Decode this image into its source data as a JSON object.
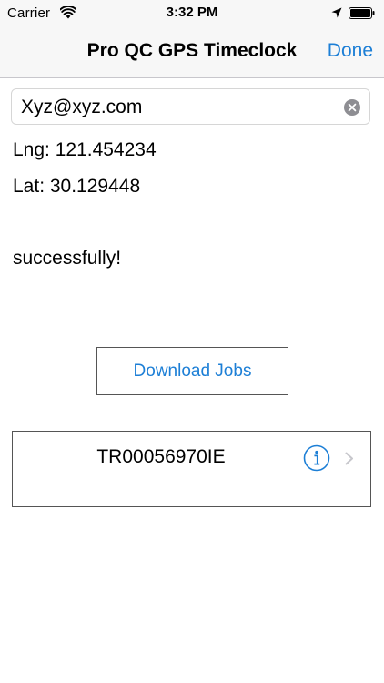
{
  "status_bar": {
    "carrier": "Carrier",
    "time": "3:32 PM"
  },
  "nav": {
    "title": "Pro QC GPS Timeclock",
    "done_label": "Done"
  },
  "email_field": {
    "value": "Xyz@xyz.com"
  },
  "location": {
    "lng_text": "Lng: 121.454234",
    "lat_text": "Lat: 30.129448"
  },
  "status_message": "successfully!",
  "download_button": {
    "label": "Download Jobs"
  },
  "jobs": [
    {
      "id": "TR00056970IE"
    }
  ],
  "colors": {
    "accent": "#1d7fd6",
    "bar_bg": "#f7f7f7"
  },
  "icons": {
    "wifi": "wifi-icon",
    "location": "location-arrow-icon",
    "battery": "battery-icon",
    "clear": "clear-text-icon",
    "info": "info-icon",
    "chevron": "chevron-right-icon"
  }
}
